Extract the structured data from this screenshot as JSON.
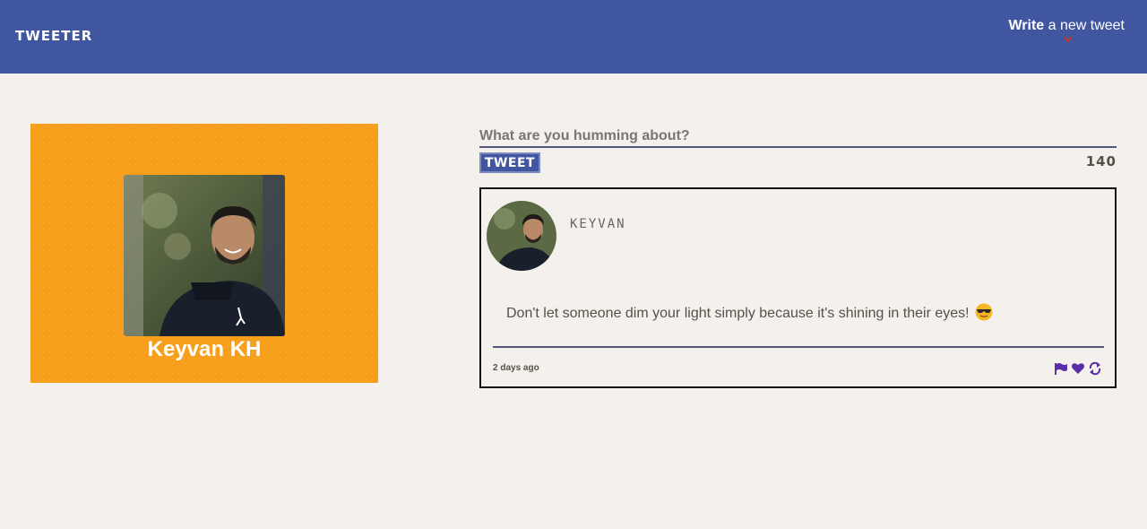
{
  "header": {
    "brand": "TWEETER",
    "write_bold": "Write",
    "write_rest": " a new tweet"
  },
  "profile": {
    "name": "Keyvan KH"
  },
  "compose": {
    "placeholder": "What are you humming about?",
    "tweet_button": "TWEET",
    "counter": "140"
  },
  "tweet": {
    "handle": "KEYVAN",
    "text": "Don't let someone dim your light simply because it's shining in their eyes!",
    "timestamp": "2 days ago",
    "actions": [
      "flag-icon",
      "heart-icon",
      "retweet-icon"
    ]
  },
  "colors": {
    "nav": "#4056a1",
    "background": "#f4f1ed",
    "card": "#f79e1b",
    "accent": "#5a2ea6"
  }
}
